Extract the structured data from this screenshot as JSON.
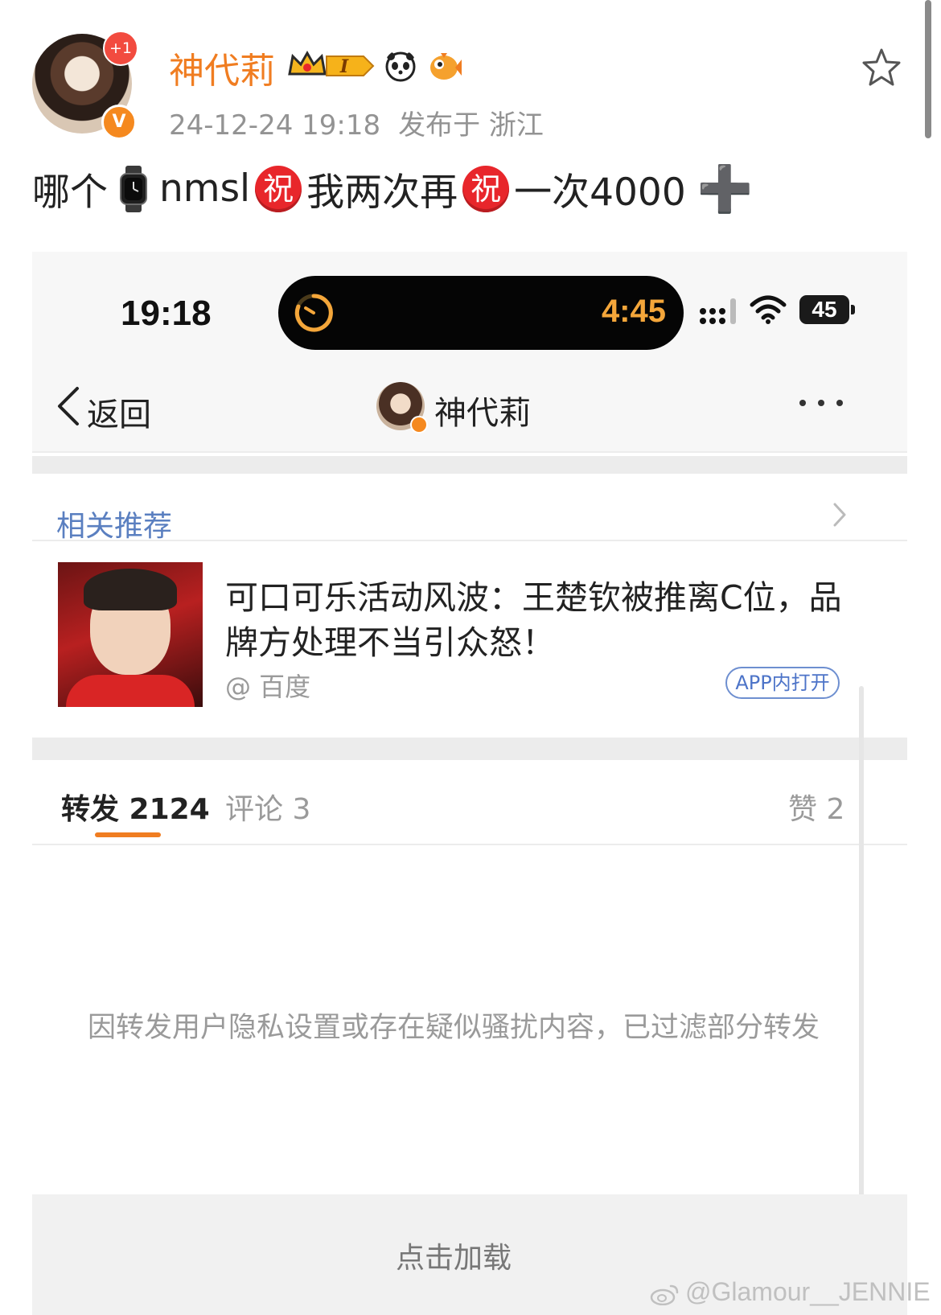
{
  "post": {
    "avatar_badge": "+1",
    "verified_mark": "V",
    "username": "神代莉",
    "level_badge": "I",
    "timestamp": "24-12-24 19:18",
    "location": "发布于 浙江",
    "text_parts": [
      "哪个",
      "nmsl",
      "祝",
      "我两次再",
      "祝",
      "一次4000",
      "➕"
    ]
  },
  "embedded": {
    "status_bar": {
      "clock": "19:18",
      "island_timer": "4:45",
      "battery": "45"
    },
    "nav": {
      "back_label": "返回",
      "title": "神代莉"
    },
    "related": {
      "header": "相关推荐"
    },
    "article": {
      "title": "可口可乐活动风波：王楚钦被推离C位，品牌方处理不当引众怒！",
      "source": "@ 百度",
      "open_button": "APP内打开"
    },
    "tabs": [
      {
        "label": "转发 2124",
        "active": true
      },
      {
        "label": "评论 3",
        "active": false
      },
      {
        "label": "赞 2",
        "active": false
      }
    ],
    "notice": "因转发用户隐私设置或存在疑似骚扰内容，已过滤部分转发",
    "load_more": "点击加载"
  },
  "watermark": "@Glamour__JENNIE",
  "colors": {
    "username": "#f07d21",
    "link_blue": "#5a7fc0",
    "tab_underline": "#f07d21",
    "red_badge": "#e8262b",
    "island_timer": "#f4a63a"
  }
}
